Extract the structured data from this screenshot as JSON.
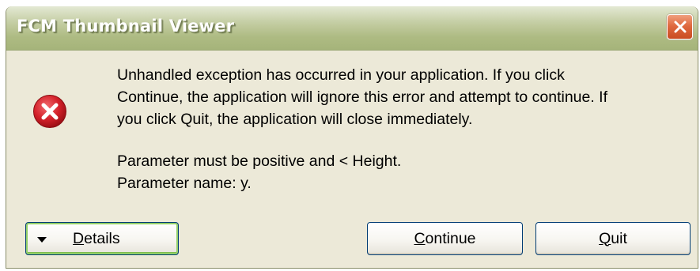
{
  "window": {
    "title": "FCM Thumbnail Viewer",
    "close_icon": "close-icon"
  },
  "dialog": {
    "icon": "error-icon",
    "message_lines": [
      "Unhandled exception has occurred in your application. If you click",
      "Continue, the application will ignore this error and attempt to continue. If",
      "you click Quit, the application will close immediately."
    ],
    "detail_lines": [
      "Parameter must be positive and < Height.",
      "Parameter name: y."
    ]
  },
  "buttons": {
    "details": {
      "mnemonic": "D",
      "rest": "etails"
    },
    "continue": {
      "mnemonic": "C",
      "rest": "ontinue"
    },
    "quit": {
      "mnemonic": "Q",
      "rest": "uit"
    }
  },
  "colors": {
    "title_bar": "#aebb83",
    "dialog_bg": "#ece9d8",
    "close_button": "#e06a40",
    "error_red": "#d4212a",
    "focus_border": "#93cf68"
  }
}
